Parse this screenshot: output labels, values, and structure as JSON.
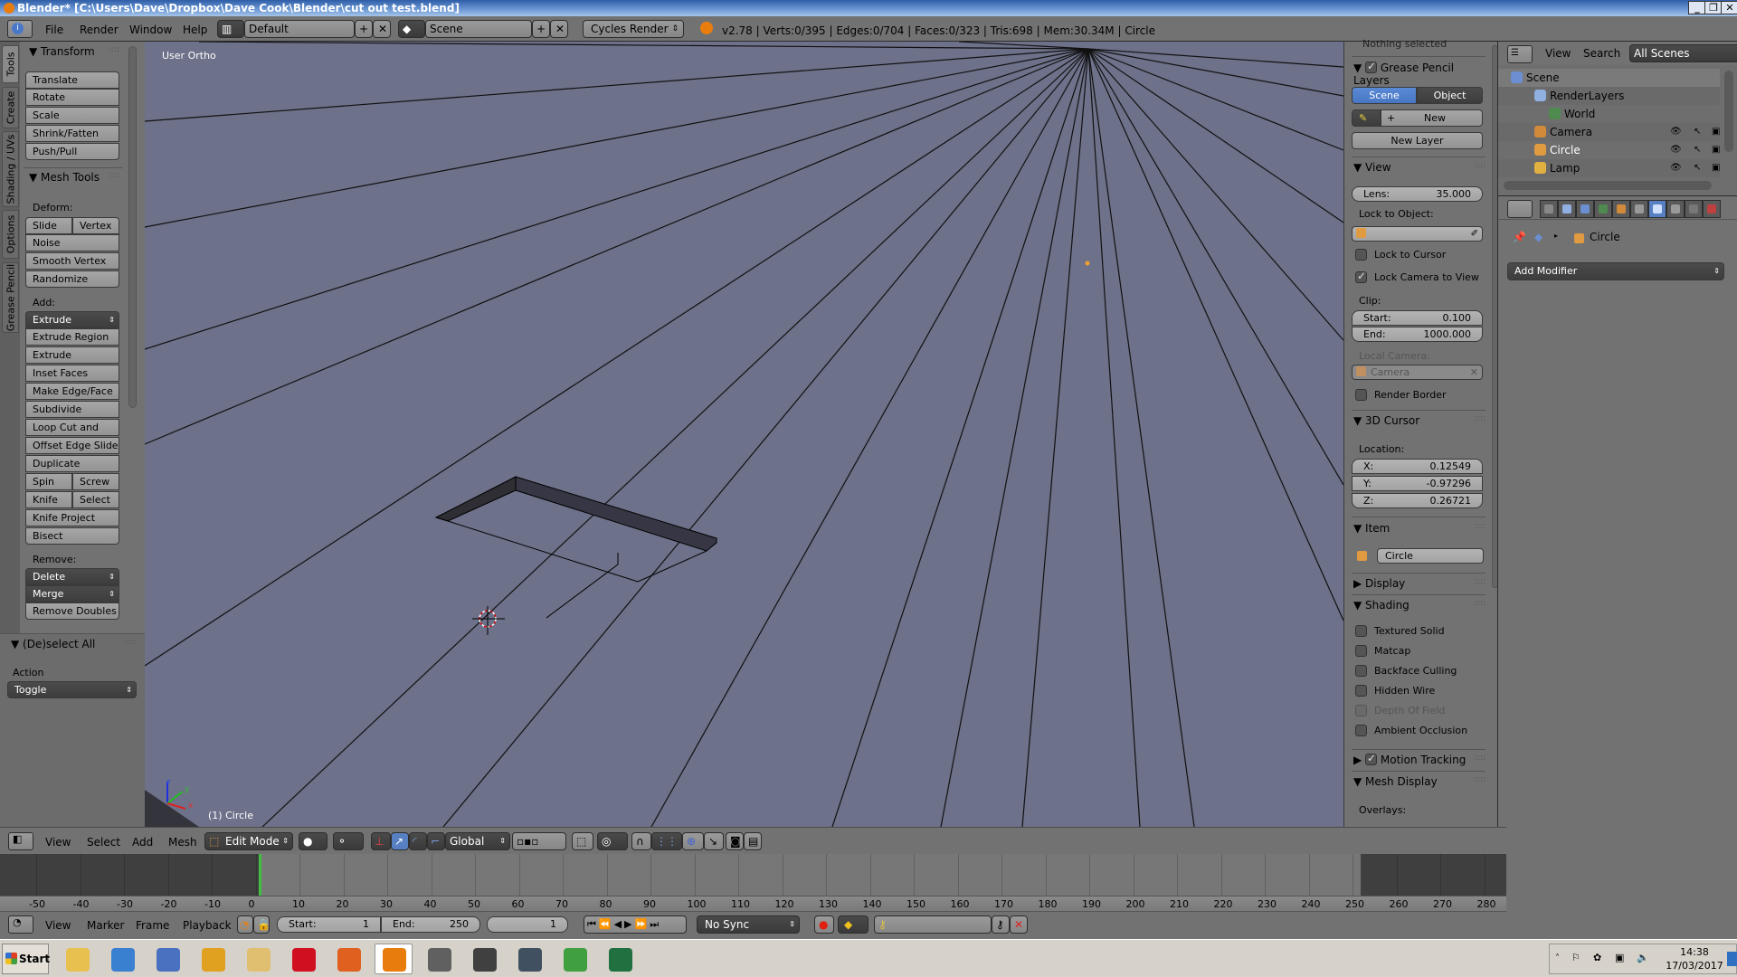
{
  "window": {
    "title": "Blender* [C:\\Users\\Dave\\Dropbox\\Dave Cook\\Blender\\cut out test.blend]",
    "controls": [
      "_",
      "❐",
      "✕"
    ]
  },
  "info_header": {
    "menus": [
      "File",
      "Render",
      "Window",
      "Help"
    ],
    "screen_layout": "Default",
    "scene": "Scene",
    "render_engine": "Cycles Render",
    "stats": "v2.78 | Verts:0/395 | Edges:0/704 | Faces:0/323 | Tris:698 | Mem:30.34M | Circle"
  },
  "tool_shelf": {
    "tabs": [
      "Tools",
      "Create",
      "Shading / UVs",
      "Options",
      "Grease Pencil"
    ],
    "active_tab": "Tools",
    "transform": {
      "title": "Transform",
      "buttons": [
        "Translate",
        "Rotate",
        "Scale",
        "Shrink/Fatten",
        "Push/Pull"
      ]
    },
    "mesh_tools": {
      "title": "Mesh Tools",
      "deform_label": "Deform:",
      "deform": [
        "Slide Ed",
        "Vertex",
        "Noise",
        "Smooth Vertex",
        "Randomize"
      ],
      "add_label": "Add:",
      "extrude_menu": "Extrude",
      "add": [
        "Extrude Region",
        "Extrude Individual",
        "Inset Faces",
        "Make Edge/Face",
        "Subdivide",
        "Loop Cut and Slide",
        "Offset Edge Slide",
        "Duplicate",
        "Spin",
        "Screw",
        "Knife",
        "Select",
        "Knife Project",
        "Bisect"
      ],
      "remove_label": "Remove:",
      "delete_menu": "Delete",
      "merge_menu": "Merge",
      "remove_doubles": "Remove Doubles"
    },
    "operator": {
      "title": "(De)select All",
      "action_label": "Action",
      "action_value": "Toggle"
    }
  },
  "viewport": {
    "view_name": "User Ortho",
    "object_label": "(1) Circle",
    "axes": {
      "x": "x",
      "y": "y",
      "z": "z"
    }
  },
  "n_panel": {
    "nothing_selected": "Nothing selected",
    "grease_pencil": {
      "title": "Grease Pencil Layers",
      "enabled": true,
      "tabs": [
        "Scene",
        "Object"
      ],
      "active_tab": "Scene",
      "new_label": "New",
      "new_layer_label": "New Layer"
    },
    "view": {
      "title": "View",
      "lens_label": "Lens:",
      "lens_value": "35.000",
      "lock_object_label": "Lock to Object:",
      "lock_cursor_label": "Lock to Cursor",
      "lock_cursor": false,
      "lock_camera_label": "Lock Camera to View",
      "lock_camera": true,
      "clip_label": "Clip:",
      "clip_start_label": "Start:",
      "clip_start": "0.100",
      "clip_end_label": "End:",
      "clip_end": "1000.000",
      "local_camera_label": "Local Camera:",
      "local_camera": "Camera",
      "render_border_label": "Render Border",
      "render_border": false
    },
    "cursor": {
      "title": "3D Cursor",
      "location_label": "Location:",
      "x_label": "X:",
      "x": "0.12549",
      "y_label": "Y:",
      "y": "-0.97296",
      "z_label": "Z:",
      "z": "0.26721"
    },
    "item": {
      "title": "Item",
      "name": "Circle"
    },
    "display": {
      "title": "Display"
    },
    "shading": {
      "title": "Shading",
      "options": [
        {
          "label": "Textured Solid",
          "checked": false,
          "disabled": false
        },
        {
          "label": "Matcap",
          "checked": false,
          "disabled": false
        },
        {
          "label": "Backface Culling",
          "checked": false,
          "disabled": false
        },
        {
          "label": "Hidden Wire",
          "checked": false,
          "disabled": false
        },
        {
          "label": "Depth Of Field",
          "checked": false,
          "disabled": true
        },
        {
          "label": "Ambient Occlusion",
          "checked": false,
          "disabled": false
        }
      ]
    },
    "motion_tracking": {
      "title": "Motion Tracking",
      "enabled": true
    },
    "mesh_display": {
      "title": "Mesh Display",
      "overlays_label": "Overlays:"
    }
  },
  "outliner": {
    "menus": [
      "View",
      "Search"
    ],
    "filter": "All Scenes",
    "items": [
      {
        "label": "Scene",
        "color": "#6b8fd0"
      },
      {
        "label": "RenderLayers",
        "color": "#8fb0e0"
      },
      {
        "label": "World",
        "color": "#4f8a4f"
      },
      {
        "label": "Camera",
        "color": "#d08a3a"
      },
      {
        "label": "Circle",
        "color": "#e09a40"
      },
      {
        "label": "Lamp",
        "color": "#e0b040"
      }
    ]
  },
  "properties": {
    "context_path": "Circle",
    "add_modifier": "Add Modifier",
    "active_tab": "modifiers"
  },
  "view3d_header": {
    "menus": [
      "View",
      "Select",
      "Add",
      "Mesh"
    ],
    "mode": "Edit Mode",
    "orientation": "Global"
  },
  "timeline": {
    "ruler_ticks": [
      "-50",
      "-40",
      "-30",
      "-20",
      "-10",
      "0",
      "10",
      "20",
      "30",
      "40",
      "50",
      "60",
      "70",
      "80",
      "90",
      "100",
      "110",
      "120",
      "130",
      "140",
      "150",
      "160",
      "170",
      "180",
      "190",
      "200",
      "210",
      "220",
      "230",
      "240",
      "250",
      "260",
      "270",
      "280"
    ],
    "menus": [
      "View",
      "Marker",
      "Frame",
      "Playback"
    ],
    "start_label": "Start:",
    "start": "1",
    "end_label": "End:",
    "end": "250",
    "current_frame": "1",
    "sync": "No Sync"
  },
  "taskbar": {
    "start_label": "Start",
    "apps": [
      "explorer",
      "media-player",
      "document-shortcut",
      "winamp",
      "mail",
      "opera",
      "firefox",
      "blender",
      "gimp",
      "world-of-tanks",
      "world-of-warships",
      "libreoffice-calc",
      "excel"
    ],
    "active_app": "blender",
    "time": "14:38",
    "date": "17/03/2017"
  }
}
